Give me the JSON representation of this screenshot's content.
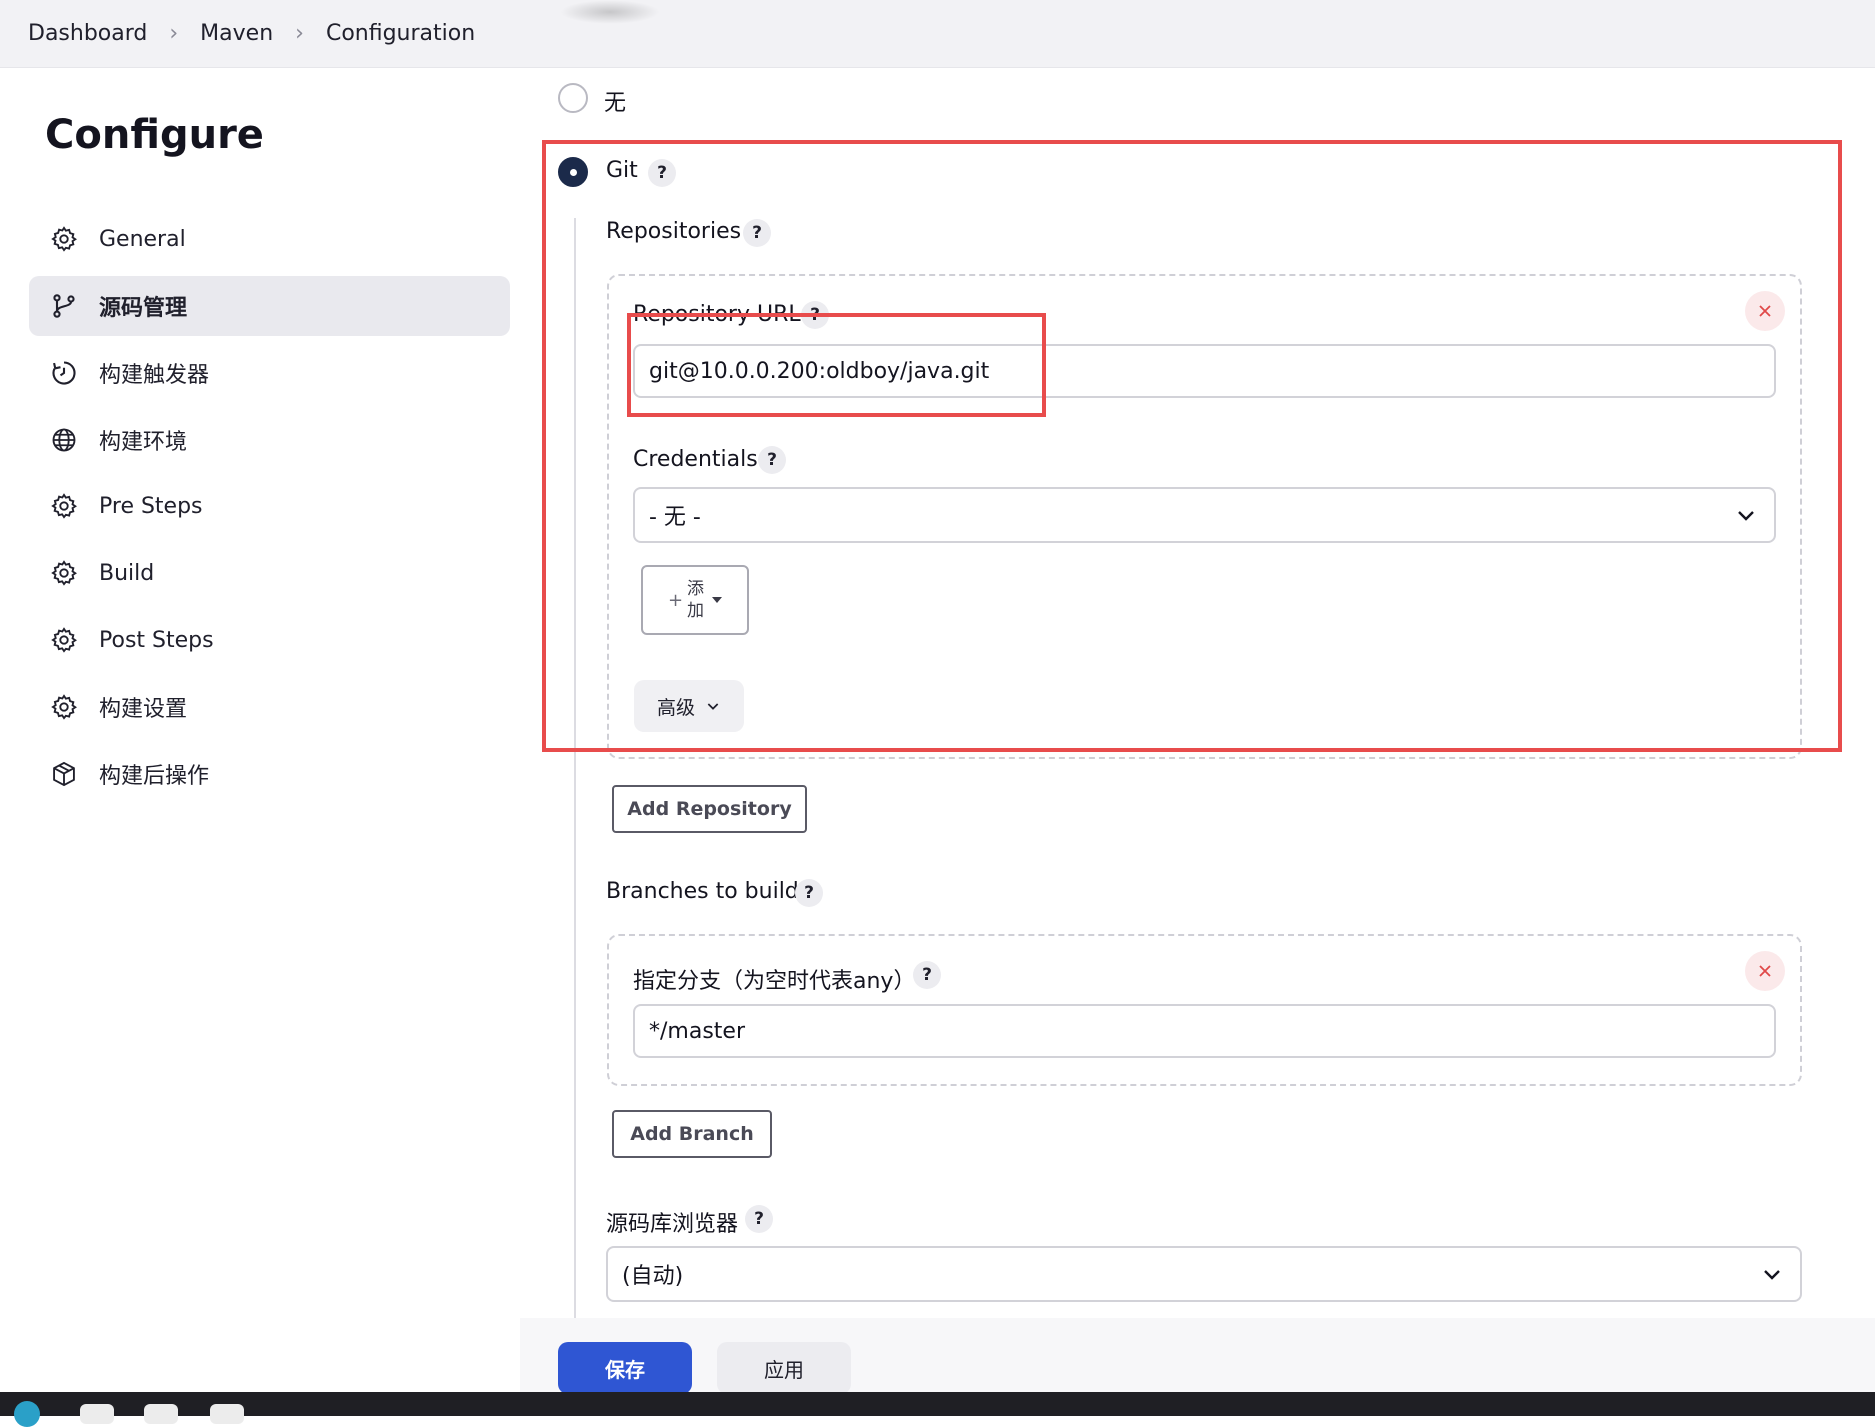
{
  "breadcrumb": {
    "items": [
      "Dashboard",
      "Maven",
      "Configuration"
    ]
  },
  "sidebar": {
    "title": "Configure",
    "items": [
      {
        "label": "General",
        "icon": "gear-icon"
      },
      {
        "label": "源码管理",
        "icon": "branch-icon",
        "active": true
      },
      {
        "label": "构建触发器",
        "icon": "clock-icon"
      },
      {
        "label": "构建环境",
        "icon": "globe-icon"
      },
      {
        "label": "Pre Steps",
        "icon": "gear-icon"
      },
      {
        "label": "Build",
        "icon": "gear-icon"
      },
      {
        "label": "Post Steps",
        "icon": "gear-icon"
      },
      {
        "label": "构建设置",
        "icon": "gear-icon"
      },
      {
        "label": "构建后操作",
        "icon": "package-icon"
      }
    ]
  },
  "scm": {
    "option_none": "无",
    "option_git": "Git",
    "help": "?",
    "repositories_label": "Repositories",
    "repository_url_label": "Repository URL",
    "repository_url_value": "git@10.0.0.200:oldboy/java.git",
    "credentials_label": "Credentials",
    "credentials_value": "- 无 -",
    "add_button_plus": "+",
    "add_button_char1": "添",
    "add_button_char2": "加",
    "advanced_label": "高级",
    "add_repository_label": "Add Repository",
    "branches_label": "Branches to build",
    "branch_specifier_label": "指定分支（为空时代表any）",
    "branch_specifier_value": "*/master",
    "add_branch_label": "Add Branch",
    "repo_browser_label": "源码库浏览器",
    "repo_browser_value": "(自动)"
  },
  "footer": {
    "save_label": "保存",
    "apply_label": "应用"
  },
  "colors": {
    "accent": "#2f56d3",
    "highlight": "#e84c4c",
    "radio_checked": "#1b2a4a"
  }
}
